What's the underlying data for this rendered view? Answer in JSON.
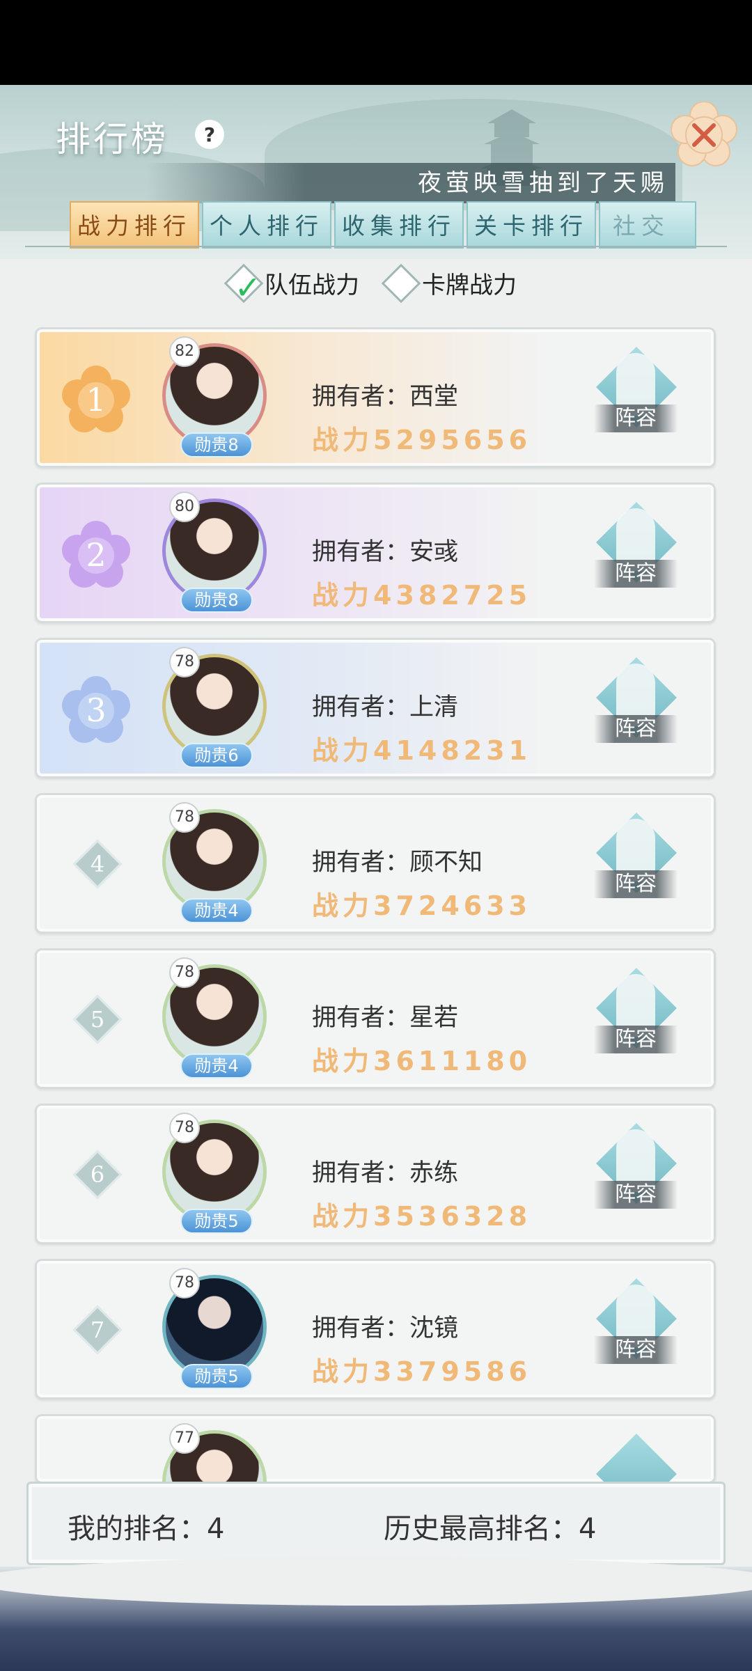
{
  "header": {
    "title": "排行榜",
    "help_icon": "?",
    "close_icon": "close-icon",
    "marquee": "夜萤映雪抽到了天赐"
  },
  "tabs": [
    {
      "label": "战力排行",
      "active": true
    },
    {
      "label": "个人排行",
      "active": false
    },
    {
      "label": "收集排行",
      "active": false
    },
    {
      "label": "关卡排行",
      "active": false
    },
    {
      "label": "社交",
      "active": false
    }
  ],
  "filters": [
    {
      "label": "队伍战力",
      "checked": true
    },
    {
      "label": "卡牌战力",
      "checked": false
    }
  ],
  "rows": [
    {
      "rank": "1",
      "level": "82",
      "noble": "勋贵8",
      "owner": "拥有者：西堂",
      "power": "战力5295656",
      "lineup": "阵容"
    },
    {
      "rank": "2",
      "level": "80",
      "noble": "勋贵8",
      "owner": "拥有者：安彧",
      "power": "战力4382725",
      "lineup": "阵容"
    },
    {
      "rank": "3",
      "level": "78",
      "noble": "勋贵6",
      "owner": "拥有者：上清",
      "power": "战力4148231",
      "lineup": "阵容"
    },
    {
      "rank": "4",
      "level": "78",
      "noble": "勋贵4",
      "owner": "拥有者：顾不知",
      "power": "战力3724633",
      "lineup": "阵容"
    },
    {
      "rank": "5",
      "level": "78",
      "noble": "勋贵4",
      "owner": "拥有者：星若",
      "power": "战力3611180",
      "lineup": "阵容"
    },
    {
      "rank": "6",
      "level": "78",
      "noble": "勋贵5",
      "owner": "拥有者：赤练",
      "power": "战力3536328",
      "lineup": "阵容"
    },
    {
      "rank": "7",
      "level": "78",
      "noble": "勋贵5",
      "owner": "拥有者：沈镜",
      "power": "战力3379586",
      "lineup": "阵容"
    },
    {
      "rank": "",
      "level": "77",
      "noble": "",
      "owner": "",
      "power": "",
      "lineup": ""
    }
  ],
  "footer": {
    "my_rank": "我的排名：4",
    "best_rank": "历史最高排名：4"
  },
  "colors": {
    "accent_gold": "#f0b978",
    "tab_active": "#f3c37a",
    "tab_inactive": "#a8d7db",
    "check_green": "#2bbd5c"
  }
}
